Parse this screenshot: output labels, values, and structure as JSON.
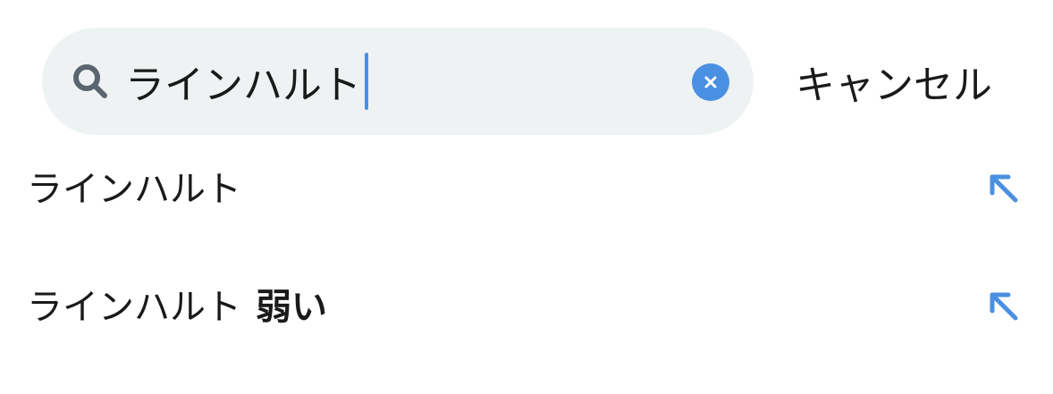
{
  "search": {
    "query": "ラインハルト",
    "clear_label": "×"
  },
  "header": {
    "cancel_label": "キャンセル"
  },
  "suggestions": [
    {
      "text": "ラインハルト",
      "suffix": ""
    },
    {
      "text": "ラインハルト",
      "suffix": "弱い"
    }
  ],
  "colors": {
    "accent": "#4a90e2",
    "search_bg": "#eef2f3",
    "text": "#1a1a1a",
    "icon_gray": "#5b6570"
  },
  "icons": {
    "search": "search-icon",
    "clear": "clear-icon",
    "fill_query": "arrow-up-left-icon"
  }
}
